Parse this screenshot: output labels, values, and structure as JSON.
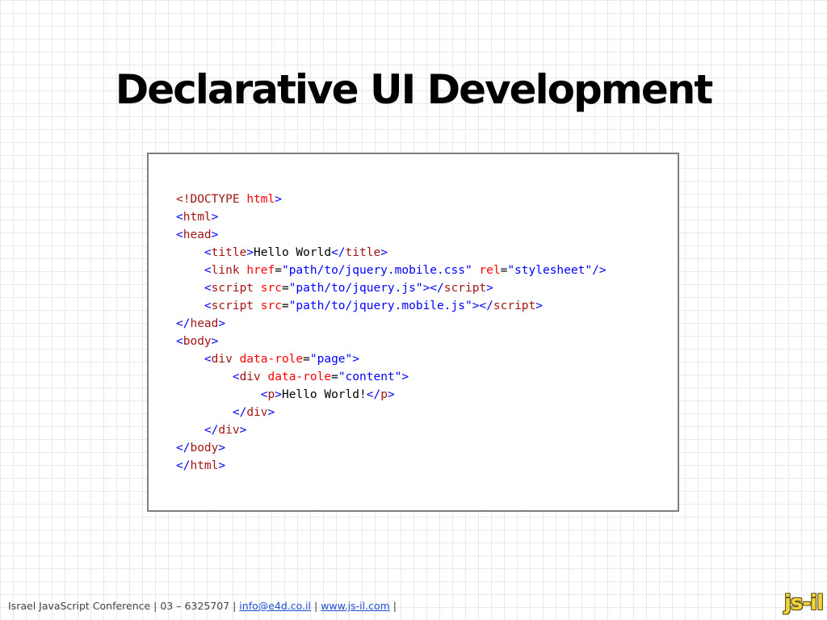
{
  "slide": {
    "title": "Declarative UI Development"
  },
  "code": {
    "lines": [
      [
        {
          "t": "<!DOCTYPE ",
          "c": "tag"
        },
        {
          "t": "html",
          "c": "attr"
        },
        {
          "t": ">",
          "c": "punct"
        }
      ],
      [
        {
          "t": "<",
          "c": "punct"
        },
        {
          "t": "html",
          "c": "tag"
        },
        {
          "t": ">",
          "c": "punct"
        }
      ],
      [
        {
          "t": "<",
          "c": "punct"
        },
        {
          "t": "head",
          "c": "tag"
        },
        {
          "t": ">",
          "c": "punct"
        }
      ],
      [
        {
          "t": "    <",
          "c": "punct"
        },
        {
          "t": "title",
          "c": "tag"
        },
        {
          "t": ">",
          "c": "punct"
        },
        {
          "t": "Hello World",
          "c": "text"
        },
        {
          "t": "</",
          "c": "punct"
        },
        {
          "t": "title",
          "c": "tag"
        },
        {
          "t": ">",
          "c": "punct"
        }
      ],
      [
        {
          "t": "    <",
          "c": "punct"
        },
        {
          "t": "link ",
          "c": "tag"
        },
        {
          "t": "href",
          "c": "attr"
        },
        {
          "t": "=",
          "c": "text"
        },
        {
          "t": "\"path/to/jquery.mobile.css\"",
          "c": "val"
        },
        {
          "t": " rel",
          "c": "attr"
        },
        {
          "t": "=",
          "c": "text"
        },
        {
          "t": "\"stylesheet\"",
          "c": "val"
        },
        {
          "t": "/>",
          "c": "punct"
        }
      ],
      [
        {
          "t": "    <",
          "c": "punct"
        },
        {
          "t": "script ",
          "c": "tag"
        },
        {
          "t": "src",
          "c": "attr"
        },
        {
          "t": "=",
          "c": "text"
        },
        {
          "t": "\"path/to/jquery.js\"",
          "c": "val"
        },
        {
          "t": "></",
          "c": "punct"
        },
        {
          "t": "script",
          "c": "tag"
        },
        {
          "t": ">",
          "c": "punct"
        }
      ],
      [
        {
          "t": "    <",
          "c": "punct"
        },
        {
          "t": "script ",
          "c": "tag"
        },
        {
          "t": "src",
          "c": "attr"
        },
        {
          "t": "=",
          "c": "text"
        },
        {
          "t": "\"path/to/jquery.mobile.js\"",
          "c": "val"
        },
        {
          "t": "></",
          "c": "punct"
        },
        {
          "t": "script",
          "c": "tag"
        },
        {
          "t": ">",
          "c": "punct"
        }
      ],
      [
        {
          "t": "</",
          "c": "punct"
        },
        {
          "t": "head",
          "c": "tag"
        },
        {
          "t": ">",
          "c": "punct"
        }
      ],
      [
        {
          "t": "<",
          "c": "punct"
        },
        {
          "t": "body",
          "c": "tag"
        },
        {
          "t": ">",
          "c": "punct"
        }
      ],
      [
        {
          "t": "    <",
          "c": "punct"
        },
        {
          "t": "div ",
          "c": "tag"
        },
        {
          "t": "data-role",
          "c": "attr"
        },
        {
          "t": "=",
          "c": "text"
        },
        {
          "t": "\"page\"",
          "c": "val"
        },
        {
          "t": ">",
          "c": "punct"
        }
      ],
      [
        {
          "t": "        <",
          "c": "punct"
        },
        {
          "t": "div ",
          "c": "tag"
        },
        {
          "t": "data-role",
          "c": "attr"
        },
        {
          "t": "=",
          "c": "text"
        },
        {
          "t": "\"content\"",
          "c": "val"
        },
        {
          "t": ">",
          "c": "punct"
        }
      ],
      [
        {
          "t": "            <",
          "c": "punct"
        },
        {
          "t": "p",
          "c": "tag"
        },
        {
          "t": ">",
          "c": "punct"
        },
        {
          "t": "Hello World!",
          "c": "text"
        },
        {
          "t": "</",
          "c": "punct"
        },
        {
          "t": "p",
          "c": "tag"
        },
        {
          "t": ">",
          "c": "punct"
        }
      ],
      [
        {
          "t": "        </",
          "c": "punct"
        },
        {
          "t": "div",
          "c": "tag"
        },
        {
          "t": ">",
          "c": "punct"
        }
      ],
      [
        {
          "t": "    </",
          "c": "punct"
        },
        {
          "t": "div",
          "c": "tag"
        },
        {
          "t": ">",
          "c": "punct"
        }
      ],
      [
        {
          "t": "</",
          "c": "punct"
        },
        {
          "t": "body",
          "c": "tag"
        },
        {
          "t": ">",
          "c": "punct"
        }
      ],
      [
        {
          "t": "</",
          "c": "punct"
        },
        {
          "t": "html",
          "c": "tag"
        },
        {
          "t": ">",
          "c": "punct"
        }
      ]
    ]
  },
  "footer": {
    "prefix": "Israel JavaScript Conference | 03 – 6325707 | ",
    "email": "info@e4d.co.il",
    "sep": " | ",
    "website": "www.js-il.com",
    "suffix": " |"
  },
  "logo": {
    "text": "js-il"
  },
  "colors": {
    "tag": "#a31515",
    "attr": "#ff0000",
    "value": "#0000ff",
    "punct": "#0000ff",
    "logo": "#f3d63a"
  }
}
